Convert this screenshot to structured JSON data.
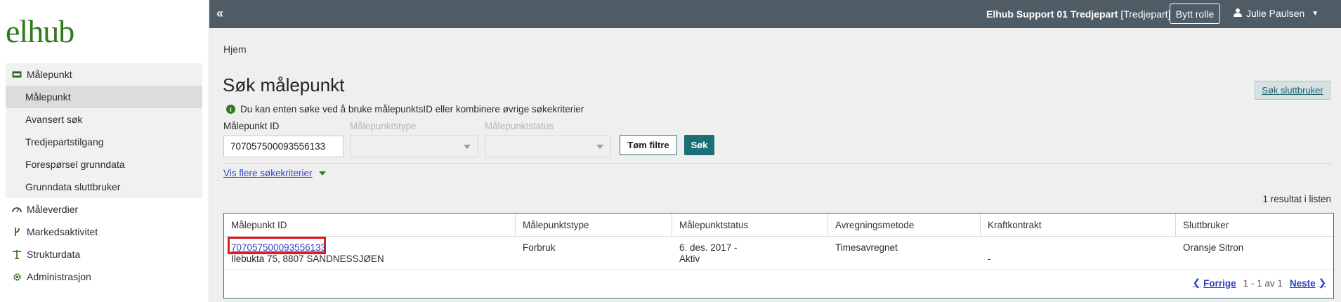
{
  "logo": "elhub",
  "sidebar": {
    "items": [
      {
        "label": "Målepunkt",
        "icon": "meter-icon",
        "level": "top"
      },
      {
        "label": "Målepunkt",
        "level": "sub",
        "active": true
      },
      {
        "label": "Avansert søk",
        "level": "sub"
      },
      {
        "label": "Tredjepartstilgang",
        "level": "sub"
      },
      {
        "label": "Forespørsel grunndata",
        "level": "sub"
      },
      {
        "label": "Grunndata sluttbruker",
        "level": "sub"
      },
      {
        "label": "Måleverdier",
        "icon": "gauge-icon",
        "level": "top"
      },
      {
        "label": "Markedsaktivitet",
        "icon": "branch-icon",
        "level": "top"
      },
      {
        "label": "Strukturdata",
        "icon": "pylon-icon",
        "level": "top"
      },
      {
        "label": "Administrasjon",
        "icon": "gear-icon",
        "level": "top"
      }
    ]
  },
  "topbar": {
    "collapse_icon": "«",
    "context": "Elhub Support 01 Tredjepart",
    "context_role": "[Tredjepart]",
    "switch_role": "Bytt rolle",
    "user_name": "Julie Paulsen"
  },
  "breadcrumb": "Hjem",
  "page_title": "Søk målepunkt",
  "search_enduser": "Søk sluttbruker",
  "info_text": "Du kan enten søke ved å bruke målepunktsID eller kombinere øvrige søkekriterier",
  "filters": {
    "mp_id_label": "Målepunkt ID",
    "mp_id_value": "707057500093556133",
    "type_label": "Målepunktstype",
    "status_label": "Målepunktstatus",
    "clear_label": "Tøm filtre",
    "search_label": "Søk",
    "more_criteria": "Vis flere søkekriterier"
  },
  "results": {
    "count_text": "1 resultat i listen",
    "columns": [
      "Målepunkt ID",
      "Målepunktstype",
      "Målepunktstatus",
      "Avregningsmetode",
      "Kraftkontrakt",
      "Sluttbruker"
    ],
    "rows": [
      {
        "mp_id": "707057500093556133",
        "address": "Ilebukta 75, 8807 SANDNESSJØEN",
        "type": "Forbruk",
        "status_date": "6. des. 2017 -",
        "status": "Aktiv",
        "settlement": "Timesavregnet",
        "contract": "-",
        "end_user": "Oransje Sitron"
      }
    ]
  },
  "pager": {
    "prev": "Forrige",
    "info": "1 - 1 av 1",
    "next": "Neste"
  },
  "colors": {
    "brand_green": "#2f7a1f",
    "topbar": "#4f5c65",
    "teal": "#1b6f77",
    "link": "#2f3fc6",
    "highlight": "#e01b22"
  }
}
